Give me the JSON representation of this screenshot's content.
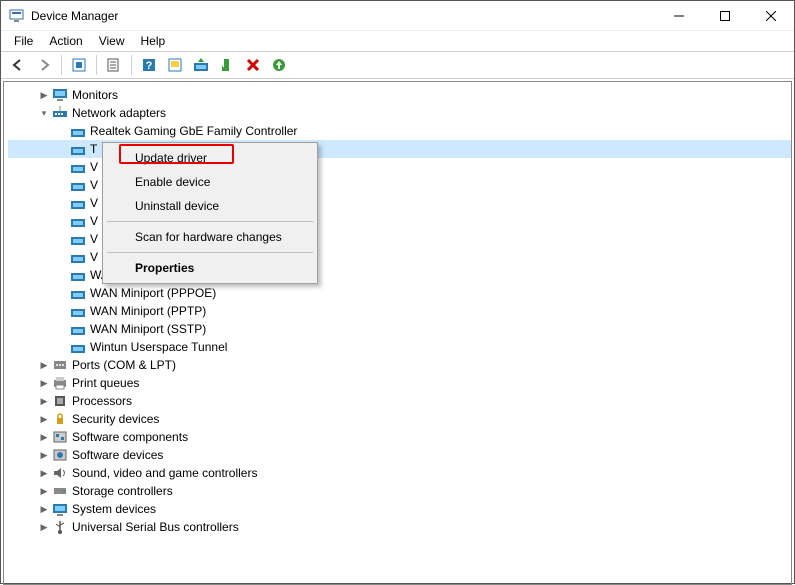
{
  "window": {
    "title": "Device Manager"
  },
  "menubar": {
    "items": [
      "File",
      "Action",
      "View",
      "Help"
    ]
  },
  "tree": {
    "monitors": {
      "label": "Monitors",
      "expanded": false
    },
    "network": {
      "label": "Network adapters",
      "expanded": true,
      "children": [
        {
          "label": "Realtek Gaming GbE Family Controller",
          "selected": false
        },
        {
          "label": "T",
          "selected": true
        },
        {
          "label": "V"
        },
        {
          "label": "V"
        },
        {
          "label": "V"
        },
        {
          "label": "V"
        },
        {
          "label": "V"
        },
        {
          "label": "V"
        },
        {
          "label": "WAN Miniport (Network Monitor)"
        },
        {
          "label": "WAN Miniport (PPPOE)"
        },
        {
          "label": "WAN Miniport (PPTP)"
        },
        {
          "label": "WAN Miniport (SSTP)"
        },
        {
          "label": "Wintun Userspace Tunnel"
        }
      ]
    },
    "other_categories": [
      {
        "label": "Ports (COM & LPT)"
      },
      {
        "label": "Print queues"
      },
      {
        "label": "Processors"
      },
      {
        "label": "Security devices"
      },
      {
        "label": "Software components"
      },
      {
        "label": "Software devices"
      },
      {
        "label": "Sound, video and game controllers"
      },
      {
        "label": "Storage controllers"
      },
      {
        "label": "System devices"
      },
      {
        "label": "Universal Serial Bus controllers"
      }
    ]
  },
  "context_menu": {
    "items": [
      {
        "label": "Update driver",
        "highlighted": true
      },
      {
        "label": "Enable device"
      },
      {
        "label": "Uninstall device"
      },
      {
        "separator": true
      },
      {
        "label": "Scan for hardware changes"
      },
      {
        "separator": true
      },
      {
        "label": "Properties",
        "bold": true
      }
    ]
  }
}
